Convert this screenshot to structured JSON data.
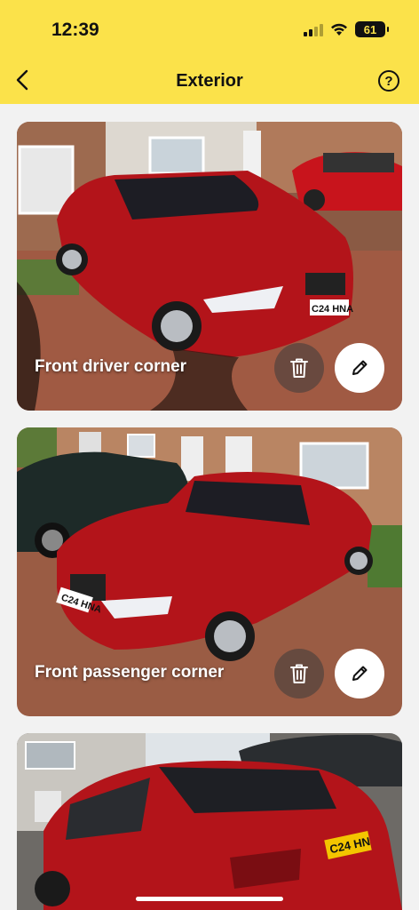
{
  "status_bar": {
    "time": "12:39",
    "battery": "61"
  },
  "header": {
    "title": "Exterior",
    "help_label": "?"
  },
  "cards": [
    {
      "label": "Front driver corner",
      "plate": "C24 HNA"
    },
    {
      "label": "Front passenger corner",
      "plate": "C24 HNA"
    },
    {
      "label": "",
      "plate": "C24 HN"
    }
  ],
  "colors": {
    "header": "#fbe24a",
    "car": "#b3141a"
  }
}
